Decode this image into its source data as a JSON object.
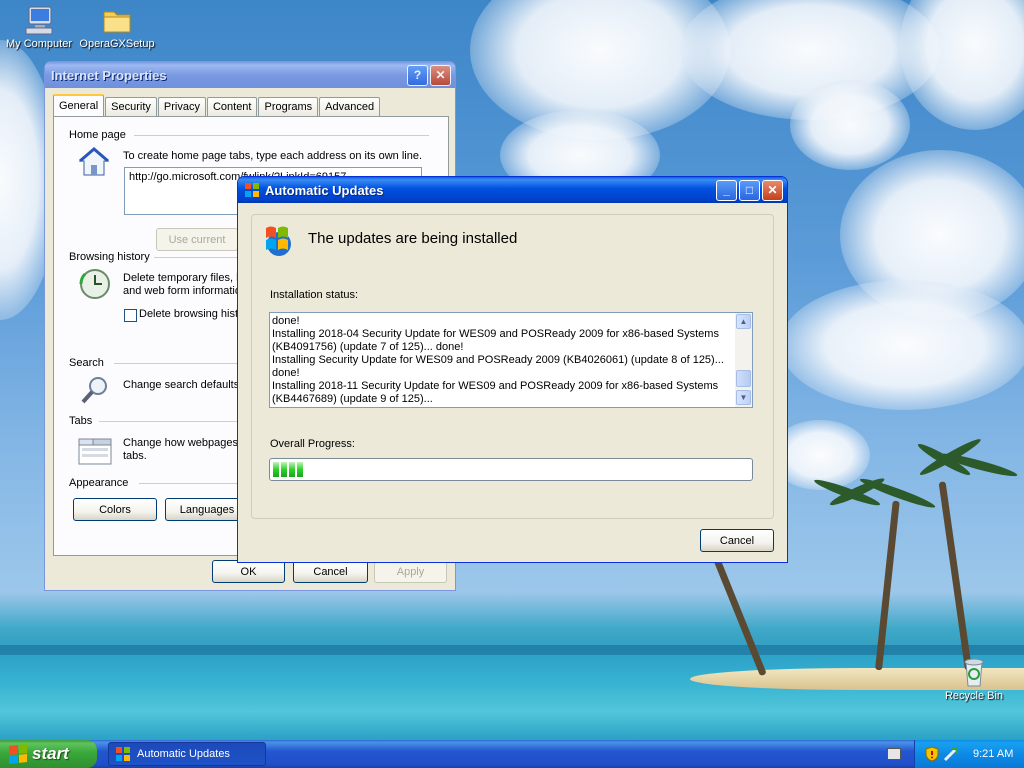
{
  "desktop": {
    "icons": [
      {
        "label": "My Computer",
        "icon": "computer-icon"
      },
      {
        "label": "OperaGXSetup",
        "icon": "folder-icon"
      },
      {
        "label": "Recycle Bin",
        "icon": "recycle-bin-icon"
      }
    ]
  },
  "internet_properties": {
    "title": "Internet Properties",
    "help_glyph": "?",
    "close_glyph": "✕",
    "tabs": [
      "General",
      "Security",
      "Privacy",
      "Content",
      "Programs",
      "Advanced"
    ],
    "selected_tab": "General",
    "home_page": {
      "heading": "Home page",
      "description": "To create home page tabs, type each address on its own line.",
      "url": "http://go.microsoft.com/fwlink/?LinkId=69157",
      "use_current": "Use current"
    },
    "browsing_history": {
      "heading": "Browsing history",
      "line1": "Delete temporary files, h",
      "line2": "and web form informatio",
      "checkbox_label": "Delete browsing histo"
    },
    "search": {
      "heading": "Search",
      "text": "Change search defaults"
    },
    "tabs_section": {
      "heading": "Tabs",
      "line1": "Change how webpages",
      "line2": "tabs."
    },
    "appearance": {
      "heading": "Appearance",
      "colors": "Colors",
      "languages": "Languages"
    },
    "buttons": {
      "ok": "OK",
      "cancel": "Cancel",
      "apply": "Apply"
    }
  },
  "automatic_updates": {
    "title": "Automatic Updates",
    "minimize_glyph": "_",
    "maximize_glyph": "□",
    "close_glyph": "✕",
    "heading": "The updates are being installed",
    "status_label": "Installation status:",
    "log": [
      "done!",
      "Installing 2018-04 Security Update for WES09 and POSReady 2009 for x86-based Systems",
      "(KB4091756) (update 7 of 125)... done!",
      "Installing Security Update for WES09 and POSReady 2009 (KB4026061) (update 8 of 125)...",
      "done!",
      "Installing 2018-11 Security Update for WES09 and POSReady 2009 for x86-based Systems",
      "(KB4467689) (update 9 of 125)..."
    ],
    "progress_label": "Overall Progress:",
    "progress_fraction": 0.072,
    "cancel": "Cancel"
  },
  "taskbar": {
    "start_label": "start",
    "active_task": "Automatic Updates",
    "clock": "9:21 AM"
  },
  "colors": {
    "title_active": "#0050e0",
    "title_inactive": "#7a99e2",
    "start_green": "#3aa83a",
    "progress_green": "#2cd22c"
  }
}
